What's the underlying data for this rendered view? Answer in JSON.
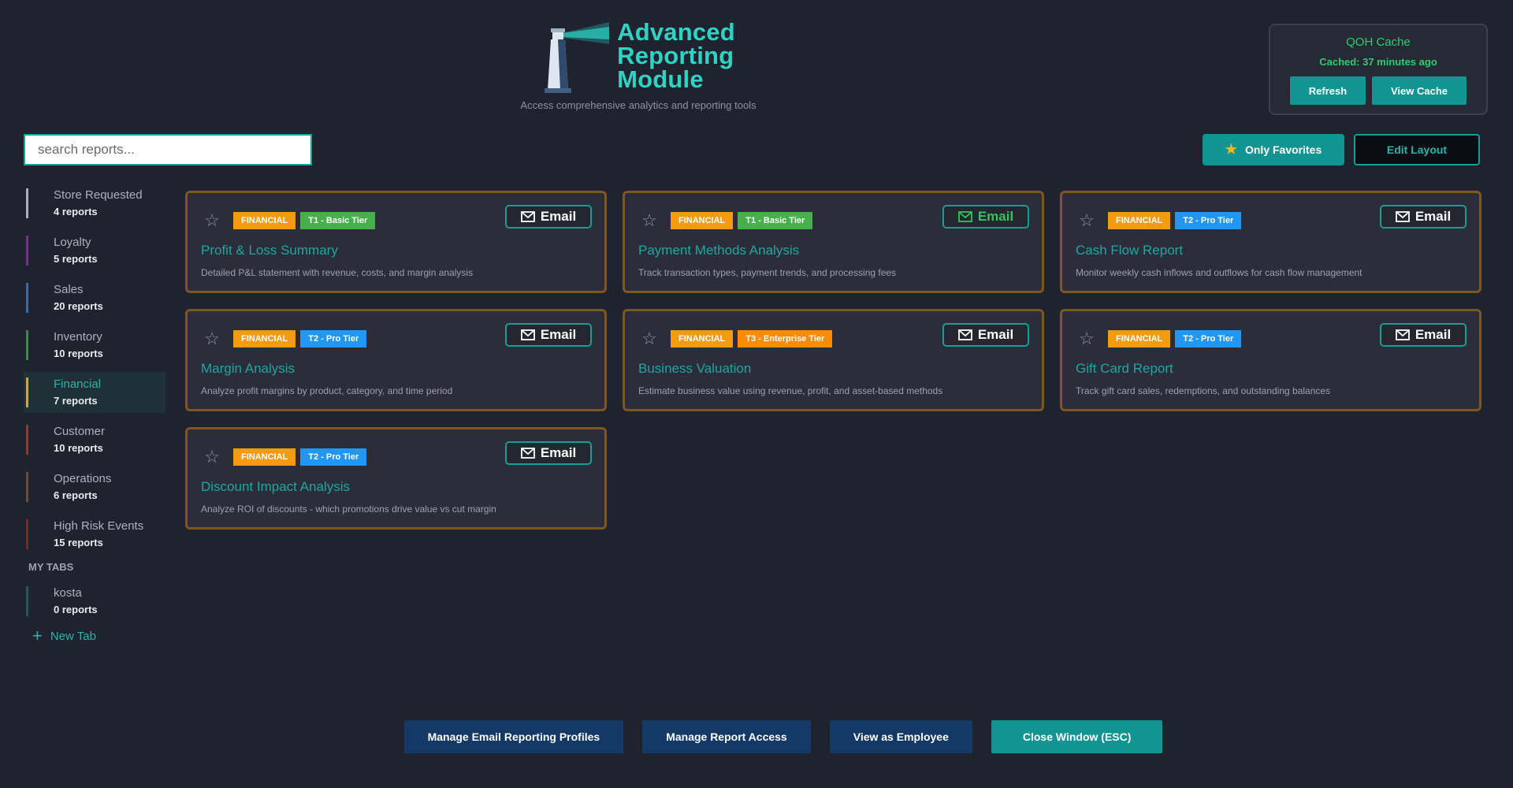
{
  "header": {
    "title_line1": "Advanced",
    "title_line2": "Reporting",
    "title_line3": "Module",
    "tagline": "Access comprehensive analytics and reporting tools"
  },
  "qoh": {
    "title": "QOH Cache",
    "status": "Cached: 37 minutes ago",
    "refresh_label": "Refresh",
    "view_label": "View Cache"
  },
  "search": {
    "placeholder": "search reports..."
  },
  "toolbar": {
    "favorites_label": "Only Favorites",
    "edit_label": "Edit Layout"
  },
  "sidebar": {
    "items": [
      {
        "label": "Store Requested",
        "count": "4 reports",
        "color": "#aab1be"
      },
      {
        "label": "Loyalty",
        "count": "5 reports",
        "color": "#7b2e8f"
      },
      {
        "label": "Sales",
        "count": "20 reports",
        "color": "#2470c2"
      },
      {
        "label": "Inventory",
        "count": "10 reports",
        "color": "#3d8a45"
      },
      {
        "label": "Financial",
        "count": "7 reports",
        "color": "#f39c12"
      },
      {
        "label": "Customer",
        "count": "10 reports",
        "color": "#b02a2a"
      },
      {
        "label": "Operations",
        "count": "6 reports",
        "color": "#6b4b3a"
      },
      {
        "label": "High Risk Events",
        "count": "15 reports",
        "color": "#8c1f24"
      }
    ],
    "my_tabs_label": "MY TABS",
    "my_tabs": [
      {
        "label": "kosta",
        "count": "0 reports",
        "color": "#1d5c58"
      }
    ],
    "new_tab_label": "New Tab"
  },
  "cards": [
    {
      "category": "FINANCIAL",
      "tier": "T1 - Basic Tier",
      "email": "Email",
      "title": "Profit & Loss Summary",
      "desc": "Detailed P&L statement with revenue, costs, and margin analysis"
    },
    {
      "category": "FINANCIAL",
      "tier": "T1 - Basic Tier",
      "email": "Email",
      "title": "Payment Methods Analysis",
      "desc": "Track transaction types, payment trends, and processing fees"
    },
    {
      "category": "FINANCIAL",
      "tier": "T2 - Pro Tier",
      "email": "Email",
      "title": "Cash Flow Report",
      "desc": "Monitor weekly cash inflows and outflows for cash flow management"
    },
    {
      "category": "FINANCIAL",
      "tier": "T2 - Pro Tier",
      "email": "Email",
      "title": "Margin Analysis",
      "desc": "Analyze profit margins by product, category, and time period"
    },
    {
      "category": "FINANCIAL",
      "tier": "T3 - Enterprise Tier",
      "email": "Email",
      "title": "Business Valuation",
      "desc": "Estimate business value using revenue, profit, and asset-based methods"
    },
    {
      "category": "FINANCIAL",
      "tier": "T2 - Pro Tier",
      "email": "Email",
      "title": "Gift Card Report",
      "desc": "Track gift card sales, redemptions, and outstanding balances"
    },
    {
      "category": "FINANCIAL",
      "tier": "T2 - Pro Tier",
      "email": "Email",
      "title": "Discount Impact Analysis",
      "desc": "Analyze ROI of discounts - which promotions drive value vs cut margin"
    }
  ],
  "footer": {
    "email_profiles": "Manage Email Reporting Profiles",
    "report_access": "Manage Report Access",
    "view_employee": "View as Employee",
    "close_window": "Close Window (ESC)"
  }
}
